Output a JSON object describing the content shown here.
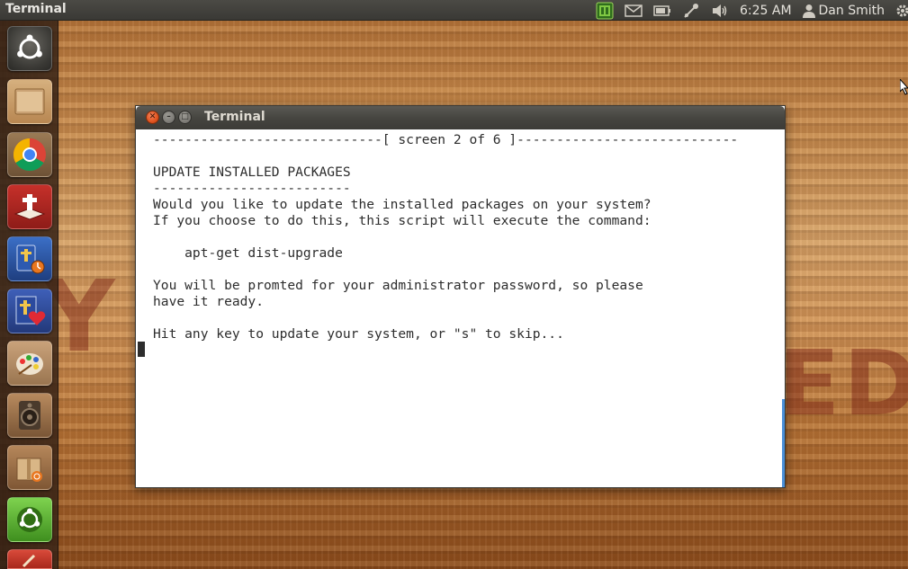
{
  "top_panel": {
    "app_title": "Terminal",
    "clock": "6:25 AM",
    "user_name": "Dan Smith",
    "indicators": [
      "network-status-icon",
      "mail-icon",
      "battery-icon",
      "bluetooth-icon",
      "volume-icon",
      "user-icon",
      "gear-icon"
    ]
  },
  "launcher": {
    "items": [
      {
        "name": "dash-home",
        "icon": "ubuntu-logo-icon"
      },
      {
        "name": "files",
        "icon": "folder-icon"
      },
      {
        "name": "chrome",
        "icon": "chrome-icon"
      },
      {
        "name": "bible-reader",
        "icon": "bible-book-icon"
      },
      {
        "name": "bible-study",
        "icon": "bible-clock-icon"
      },
      {
        "name": "bible-heart",
        "icon": "cross-heart-icon"
      },
      {
        "name": "paint",
        "icon": "paint-palette-icon"
      },
      {
        "name": "speaker-app",
        "icon": "speaker-icon"
      },
      {
        "name": "package-installer",
        "icon": "package-box-icon"
      },
      {
        "name": "ubuntu-software",
        "icon": "ubuntu-green-icon"
      },
      {
        "name": "partial-app",
        "icon": "pencil-icon"
      }
    ]
  },
  "window": {
    "title": "Terminal",
    "terminal_lines": [
      "-----------------------------[ screen 2 of 6 ]----------------------------",
      "",
      "UPDATE INSTALLED PACKAGES",
      "-------------------------",
      "Would you like to update the installed packages on your system?",
      "If you choose to do this, this script will execute the command:",
      "",
      "    apt-get dist-upgrade",
      "",
      "You will be promted for your administrator password, so please",
      "have it ready.",
      "",
      "Hit any key to update your system, or \"s\" to skip..."
    ]
  },
  "wallpaper": {
    "left_letters": "Y",
    "right_letters": "ED"
  },
  "colors": {
    "panel_bg": "#3c3b37",
    "close_button": "#e0531f",
    "scrollbar": "#4a90d9",
    "terminal_bg": "#ffffff",
    "terminal_text": "#2d2d2d"
  }
}
